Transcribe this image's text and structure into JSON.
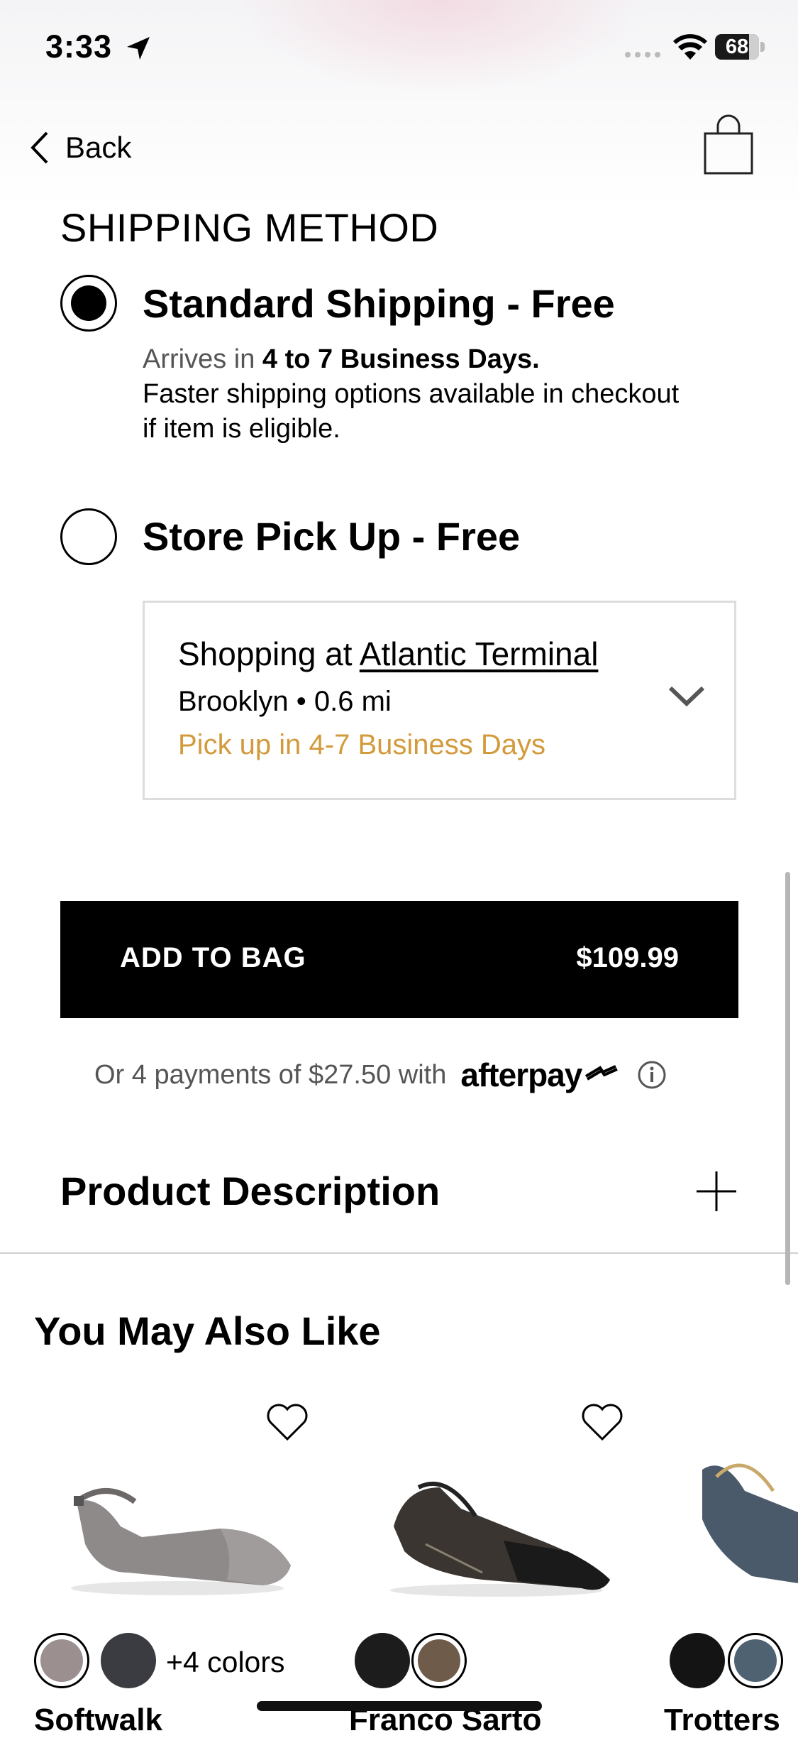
{
  "status_bar": {
    "time": "3:33",
    "battery": "68"
  },
  "header": {
    "back_label": "Back"
  },
  "shipping": {
    "title": "SHIPPING METHOD",
    "standard_label": "Standard Shipping - Free",
    "arrives_prefix": "Arrives in ",
    "arrives_days": "4 to 7 Business Days.",
    "faster_note_1": "Faster shipping options available in checkout",
    "faster_note_2": "if item is eligible.",
    "pickup_label": "Store Pick Up - Free",
    "store": {
      "prefix": "Shopping at ",
      "name": "Atlantic Terminal",
      "location": "Brooklyn • 0.6 mi",
      "pickup_eta": "Pick up in 4-7 Business Days"
    }
  },
  "add_to_bag": {
    "label": "ADD TO BAG",
    "price": "$109.99"
  },
  "afterpay": {
    "text": "Or 4 payments of $27.50 with",
    "brand": "afterpay"
  },
  "product_description": {
    "title": "Product Description"
  },
  "recommendations": {
    "title": "You May Also Like",
    "items": [
      {
        "brand": "Softwalk",
        "more_colors": "+4 colors"
      },
      {
        "brand": "Franco Sarto"
      },
      {
        "brand": "Trotters"
      }
    ]
  },
  "colors": {
    "accent_orange": "#d39a3b",
    "button_bg": "#000000"
  }
}
